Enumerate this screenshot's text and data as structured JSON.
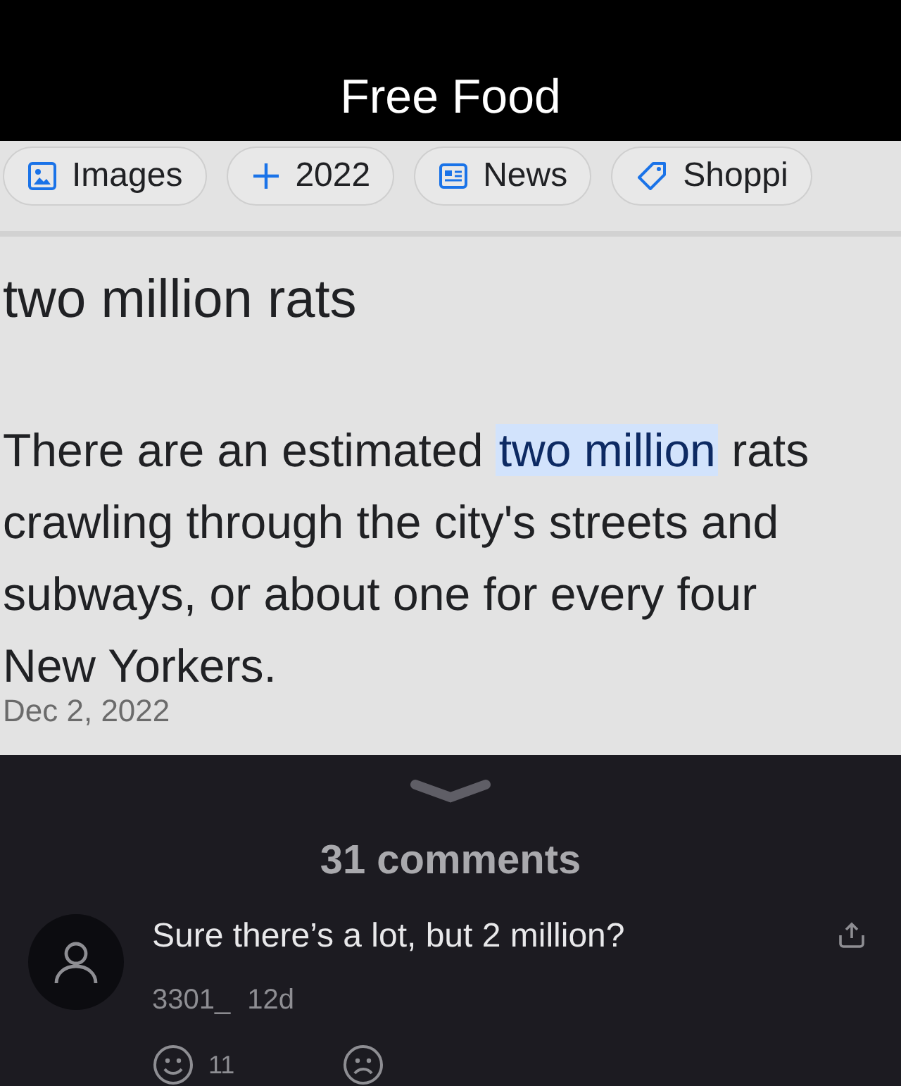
{
  "post_title": "Free Food",
  "chips": [
    {
      "kind": "image",
      "label": "Images"
    },
    {
      "kind": "plus",
      "label": "2022"
    },
    {
      "kind": "news",
      "label": "News"
    },
    {
      "kind": "tag",
      "label": "Shoppi"
    }
  ],
  "result_heading": "two million rats",
  "snippet": [
    {
      "text": "There are an estimated ",
      "highlighted": false
    },
    {
      "text": "two million",
      "highlighted": true
    },
    {
      "text": " rats crawling through the city's streets and subways, or about one for every four New Yorkers.",
      "highlighted": false
    }
  ],
  "date": "Dec 2, 2022",
  "comments_count": "31 comments",
  "comments": [
    {
      "text": "Sure there’s a lot, but 2 million?",
      "user": "3301_",
      "age": "12d",
      "likes": "11"
    }
  ]
}
